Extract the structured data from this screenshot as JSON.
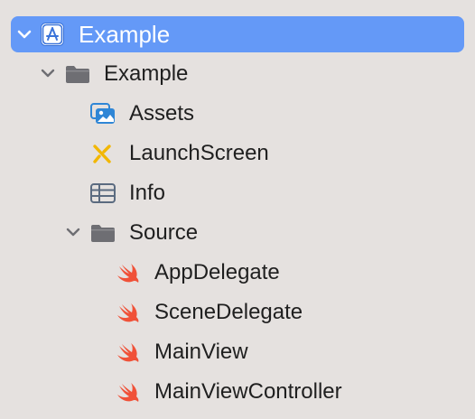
{
  "tree": {
    "project": {
      "label": "Example",
      "icon": "xcode-project-icon",
      "expanded": true,
      "selected": true
    },
    "group_example": {
      "label": "Example",
      "icon": "folder-icon",
      "expanded": true
    },
    "assets": {
      "label": "Assets",
      "icon": "asset-catalog-icon"
    },
    "launchscreen": {
      "label": "LaunchScreen",
      "icon": "storyboard-icon"
    },
    "info": {
      "label": "Info",
      "icon": "plist-table-icon"
    },
    "group_source": {
      "label": "Source",
      "icon": "folder-icon",
      "expanded": true
    },
    "files": [
      {
        "label": "AppDelegate",
        "icon": "swift-icon"
      },
      {
        "label": "SceneDelegate",
        "icon": "swift-icon"
      },
      {
        "label": "MainView",
        "icon": "swift-icon"
      },
      {
        "label": "MainViewController",
        "icon": "swift-icon"
      }
    ]
  },
  "colors": {
    "selection": "#6499f7",
    "background": "#e5e1df",
    "folder": "#6e6e73",
    "swift": "#f05138",
    "assets": "#2f86d6",
    "storyboard": "#f2b705",
    "table": "#5b6b80"
  }
}
